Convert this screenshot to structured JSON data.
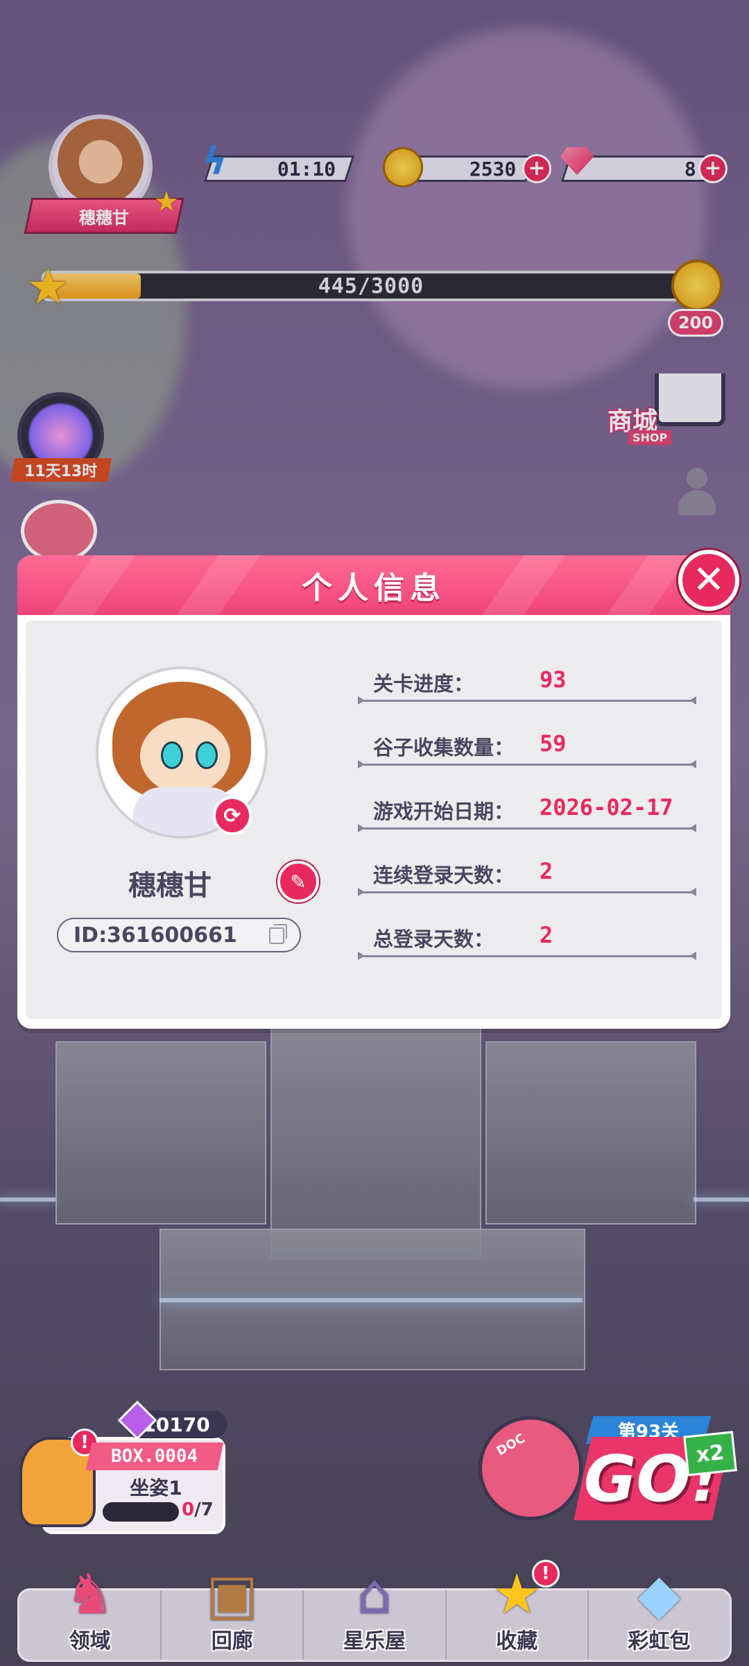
{
  "player": {
    "name": "穗穗甘"
  },
  "resources": {
    "energy": "01:10",
    "coins": "2530",
    "gems": "8"
  },
  "xp": {
    "text": "445/3000",
    "fraction": 0.148,
    "reward": "200"
  },
  "shop": {
    "label": "商城",
    "sub": "SHOP"
  },
  "event_timer": "11天13时",
  "modal": {
    "title": "个人信息",
    "name": "穗穗甘",
    "id": "ID:361600661",
    "stats": [
      {
        "label": "关卡进度：",
        "value": "93"
      },
      {
        "label": "谷子收集数量：",
        "value": "59"
      },
      {
        "label": "游戏开始日期：",
        "value": "2026-02-17"
      },
      {
        "label": "连续登录天数：",
        "value": "2"
      },
      {
        "label": "总登录天数：",
        "value": "2"
      }
    ]
  },
  "box": {
    "gems": "10170",
    "title": "BOX.0004",
    "subtitle": "坐姿1",
    "progress_done": "0",
    "progress_total": "/7"
  },
  "go": {
    "stage": "第93关",
    "label": "GO!",
    "mult": "x2",
    "badge": "DOC"
  },
  "nav": [
    {
      "label": "领域",
      "icon": "pedestal-icon"
    },
    {
      "label": "回廊",
      "icon": "frame-icon"
    },
    {
      "label": "星乐屋",
      "icon": "house-icon"
    },
    {
      "label": "收藏",
      "icon": "star-icon"
    },
    {
      "label": "彩虹包",
      "icon": "gem-icon"
    }
  ],
  "colors": {
    "accent": "#e8295e",
    "header": "#f0437a",
    "text": "#4b4660"
  }
}
